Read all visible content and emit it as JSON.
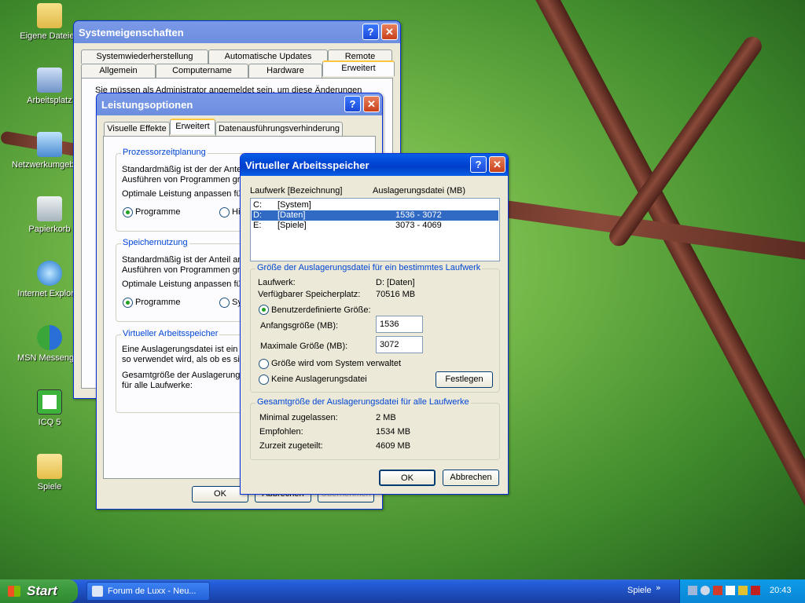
{
  "desktop": {
    "icons": [
      {
        "label": "Eigene Dateien",
        "icon": "folder-docs-icon"
      },
      {
        "label": "Arbeitsplatz",
        "icon": "computer-icon"
      },
      {
        "label": "Netzwerkumgebung",
        "icon": "network-icon"
      },
      {
        "label": "Papierkorb",
        "icon": "recycle-bin-icon"
      },
      {
        "label": "Internet Explorer",
        "icon": "ie-icon"
      },
      {
        "label": "MSN Messenger",
        "icon": "msn-icon"
      },
      {
        "label": "ICQ 5",
        "icon": "icq-icon"
      },
      {
        "label": "Spiele",
        "icon": "folder-icon"
      }
    ]
  },
  "sysprops": {
    "title": "Systemeigenschaften",
    "tabs_row1": [
      "Systemwiederherstellung",
      "Automatische Updates",
      "Remote"
    ],
    "tabs_row2": [
      "Allgemein",
      "Computername",
      "Hardware",
      "Erweitert"
    ],
    "admin_text": "Sie müssen als Administrator angemeldet sein, um diese Änderungen"
  },
  "perf": {
    "title": "Leistungsoptionen",
    "tabs": [
      "Visuelle Effekte",
      "Erweitert",
      "Datenausführungsverhinderung"
    ],
    "cpu_group": "Prozessorzeitplanung",
    "cpu_text1": "Standardmäßig ist der der Ante",
    "cpu_text2": "Ausführen von Programmen gr",
    "cpu_text3": "Optimale Leistung anpassen für",
    "cpu_radio1": "Programme",
    "cpu_radio2": "Hi",
    "mem_group": "Speichernutzung",
    "mem_text1": "Standardmäßig ist der Anteil an",
    "mem_text2": "Ausführen von Programmen gr",
    "mem_text3": "Optimale Leistung anpassen für",
    "mem_radio1": "Programme",
    "mem_radio2": "Sy",
    "vm_group": "Virtueller Arbeitsspeicher",
    "vm_text1": "Eine Auslagerungsdatei ist ein B",
    "vm_text2": "so verwendet wird, als ob es sie",
    "vm_text3": "Gesamtgröße der Auslagerungs",
    "vm_text4": "für alle Laufwerke:",
    "ok": "OK",
    "cancel": "Abbrechen",
    "apply": "Übernehmen"
  },
  "vmem": {
    "title": "Virtueller Arbeitsspeicher",
    "col_drive": "Laufwerk [Bezeichnung]",
    "col_paging": "Auslagerungsdatei (MB)",
    "drives": [
      {
        "letter": "C:",
        "name": "[System]",
        "size": ""
      },
      {
        "letter": "D:",
        "name": "[Daten]",
        "size": "1536 - 3072"
      },
      {
        "letter": "E:",
        "name": "[Spiele]",
        "size": "3073 - 4069"
      }
    ],
    "size_group": "Größe der Auslagerungsdatei für ein bestimmtes Laufwerk",
    "drive_label": "Laufwerk:",
    "drive_value": "D:  [Daten]",
    "free_label": "Verfügbarer Speicherplatz:",
    "free_value": "70516 MB",
    "custom_radio": "Benutzerdefinierte Größe:",
    "initial_label": "Anfangsgröße (MB):",
    "initial_value": "1536",
    "max_label": "Maximale Größe (MB):",
    "max_value": "3072",
    "system_radio": "Größe wird vom System verwaltet",
    "none_radio": "Keine Auslagerungsdatei",
    "set_button": "Festlegen",
    "total_group": "Gesamtgröße der Auslagerungsdatei für alle Laufwerke",
    "min_label": "Minimal zugelassen:",
    "min_value": "2 MB",
    "rec_label": "Empfohlen:",
    "rec_value": "1534 MB",
    "cur_label": "Zurzeit zugeteilt:",
    "cur_value": "4609 MB",
    "ok": "OK",
    "cancel": "Abbrechen"
  },
  "taskbar": {
    "start": "Start",
    "task": "Forum de Luxx - Neu...",
    "toolbar": "Spiele",
    "clock": "20:43"
  }
}
